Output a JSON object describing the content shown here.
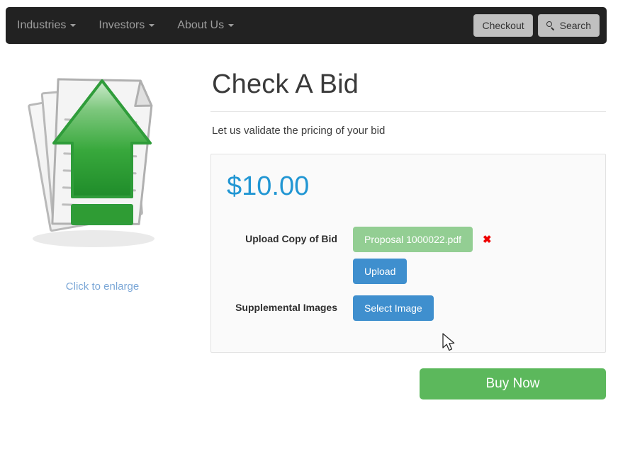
{
  "navbar": {
    "items": [
      {
        "label": "Industries",
        "has_caret": true
      },
      {
        "label": "Investors",
        "has_caret": true
      },
      {
        "label": "About Us",
        "has_caret": true
      }
    ],
    "checkout_label": "Checkout",
    "search_label": "Search",
    "background_color": "#222222",
    "link_color": "#9d9d9d"
  },
  "product_image": {
    "alt": "stacked documents with green upload arrow",
    "enlarge_label": "Click to enlarge",
    "link_color": "#7ba7d7"
  },
  "main": {
    "title": "Check A Bid",
    "subtitle": "Let us validate the pricing of your bid",
    "price": "$10.00",
    "price_color": "#2196d3",
    "fields": [
      {
        "label": "Upload Copy of Bid",
        "file_name": "Proposal 1000022.pdf",
        "file_badge_color": "#93ce93",
        "remove_icon": "✖",
        "remove_color": "#ee0000",
        "button_label": "Upload",
        "button_color": "#3f8fce"
      },
      {
        "label": "Supplemental Images",
        "button_label": "Select Image",
        "button_color": "#3f8fce"
      }
    ],
    "buy_label": "Buy Now",
    "buy_color": "#5cb85c"
  }
}
